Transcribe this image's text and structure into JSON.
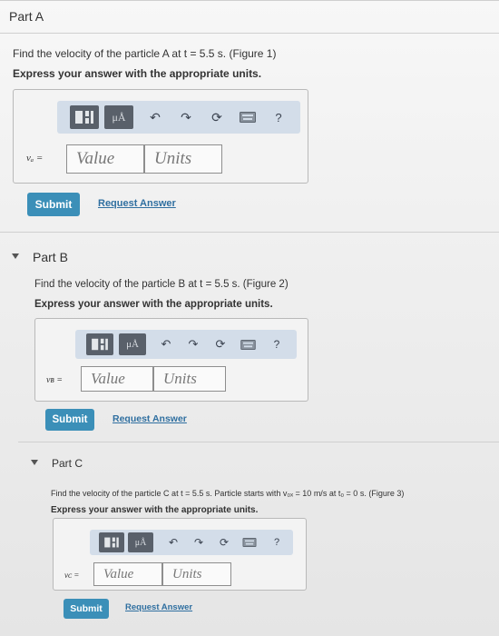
{
  "part_a": {
    "title": "Part A",
    "question": "Find the velocity of the particle A at t = 5.5 s. (Figure 1)",
    "instruction": "Express your answer with the appropriate units.",
    "var_label": "vₐ =",
    "value_placeholder": "Value",
    "units_placeholder": "Units",
    "submit_label": "Submit",
    "request_label": "Request Answer"
  },
  "part_b": {
    "title": "Part B",
    "question": "Find the velocity of the particle B at t = 5.5 s. (Figure 2)",
    "instruction": "Express your answer with the appropriate units.",
    "var_label": "vʙ =",
    "value_placeholder": "Value",
    "units_placeholder": "Units",
    "submit_label": "Submit",
    "request_label": "Request Answer"
  },
  "part_c": {
    "title": "Part C",
    "question": "Find the velocity of the particle C at t = 5.5 s. Particle starts with v₀ₓ = 10 m/s at t₀ = 0 s. (Figure 3)",
    "instruction": "Express your answer with the appropriate units.",
    "var_label": "vᴄ =",
    "value_placeholder": "Value",
    "units_placeholder": "Units",
    "submit_label": "Submit",
    "request_label": "Request Answer"
  },
  "toolbar": {
    "mu_label": "μÅ",
    "help_label": "?"
  },
  "colors": {
    "accent": "#3b8fb8",
    "toolbar_bg": "#d3dde9",
    "link": "#2f6fa0"
  }
}
